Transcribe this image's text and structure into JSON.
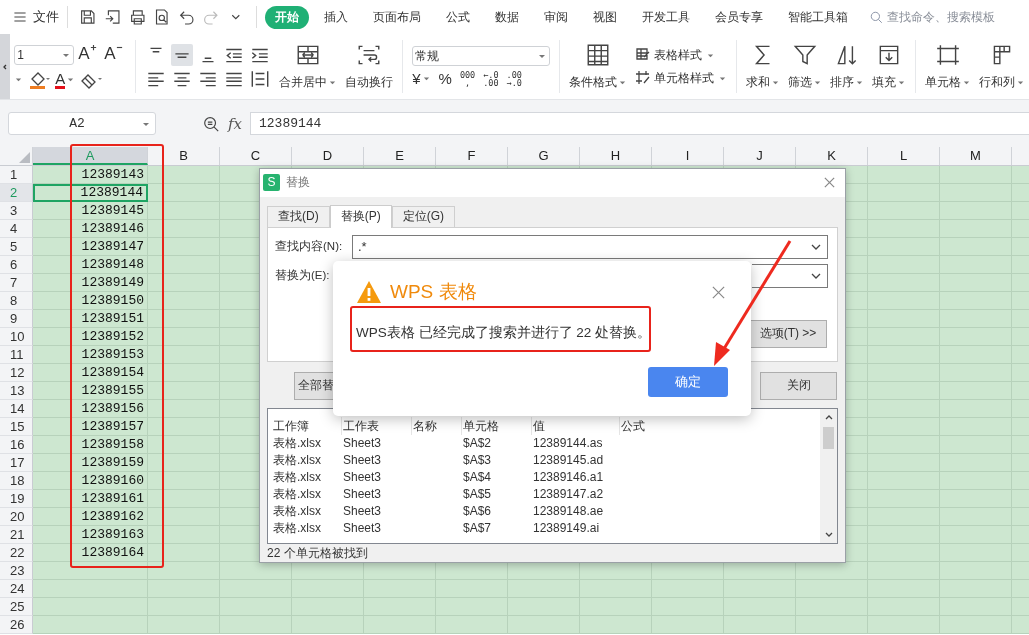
{
  "menu": {
    "file": "文件",
    "quick_access": [
      {
        "kind": "save",
        "disabled": false
      },
      {
        "kind": "export",
        "disabled": false
      },
      {
        "kind": "print",
        "disabled": false
      },
      {
        "kind": "preview",
        "disabled": false
      },
      {
        "kind": "undo",
        "disabled": false
      },
      {
        "kind": "redo",
        "disabled": true
      },
      {
        "kind": "more",
        "disabled": false
      }
    ],
    "tabs": [
      {
        "label": "开始",
        "selected": true
      },
      {
        "label": "插入",
        "selected": false
      },
      {
        "label": "页面布局",
        "selected": false
      },
      {
        "label": "公式",
        "selected": false
      },
      {
        "label": "数据",
        "selected": false
      },
      {
        "label": "审阅",
        "selected": false
      },
      {
        "label": "视图",
        "selected": false
      },
      {
        "label": "开发工具",
        "selected": false
      },
      {
        "label": "会员专享",
        "selected": false
      },
      {
        "label": "智能工具箱",
        "selected": false
      }
    ],
    "search": {
      "placeholder": "查找命令、搜索模板"
    }
  },
  "ribbon": {
    "font_size": "1",
    "font_grow": "A",
    "font_shrink": "A",
    "font_color": "A",
    "align_top": [
      {
        "kind": "top",
        "selected": false
      },
      {
        "kind": "middle",
        "selected": true
      },
      {
        "kind": "bottom",
        "selected": false
      },
      {
        "kind": "outdent",
        "selected": false
      },
      {
        "kind": "indent",
        "selected": false
      }
    ],
    "align_bottom": [
      {
        "kind": "left",
        "selected": false
      },
      {
        "kind": "center",
        "selected": false
      },
      {
        "kind": "right",
        "selected": false
      },
      {
        "kind": "justify",
        "selected": false
      },
      {
        "kind": "distributed",
        "selected": false
      }
    ],
    "merge": {
      "label": "合并居中",
      "kind": "merge"
    },
    "wrap": {
      "label": "自动换行",
      "kind": "wrap"
    },
    "number_format": "常规",
    "currency": "¥",
    "percent": "%",
    "thousands": [
      "000",
      ","
    ],
    "inc_decimal": [
      "←.0",
      ".00"
    ],
    "dec_decimal": [
      ".00",
      "→.0"
    ],
    "conditional": {
      "label": "条件格式",
      "kind": "conditional"
    },
    "table_style": "表格样式",
    "cell_style": "单元格样式",
    "tools": [
      {
        "label": "求和",
        "kind": "sum"
      },
      {
        "label": "筛选",
        "kind": "filter"
      },
      {
        "label": "排序",
        "kind": "sort"
      },
      {
        "label": "填充",
        "kind": "fill"
      }
    ],
    "cells": [
      {
        "label": "单元格",
        "kind": "cell"
      },
      {
        "label": "行和列",
        "kind": "rowcol"
      }
    ]
  },
  "formula_bar": {
    "name_box": "A2",
    "fx": "fx",
    "value": "12389144"
  },
  "sheet": {
    "columns": [
      {
        "label": "A",
        "selected": true
      },
      {
        "label": "B",
        "selected": false
      },
      {
        "label": "C",
        "selected": false
      },
      {
        "label": "D",
        "selected": false
      },
      {
        "label": "E",
        "selected": false
      },
      {
        "label": "F",
        "selected": false
      },
      {
        "label": "G",
        "selected": false
      },
      {
        "label": "H",
        "selected": false
      },
      {
        "label": "I",
        "selected": false
      },
      {
        "label": "J",
        "selected": false
      },
      {
        "label": "K",
        "selected": false
      },
      {
        "label": "L",
        "selected": false
      },
      {
        "label": "M",
        "selected": false
      }
    ],
    "rows": [
      {
        "number": "1",
        "value": "12389143",
        "selected": false
      },
      {
        "number": "2",
        "value": "12389144",
        "selected": true
      },
      {
        "number": "3",
        "value": "12389145",
        "selected": false
      },
      {
        "number": "4",
        "value": "12389146",
        "selected": false
      },
      {
        "number": "5",
        "value": "12389147",
        "selected": false
      },
      {
        "number": "6",
        "value": "12389148",
        "selected": false
      },
      {
        "number": "7",
        "value": "12389149",
        "selected": false
      },
      {
        "number": "8",
        "value": "12389150",
        "selected": false
      },
      {
        "number": "9",
        "value": "12389151",
        "selected": false
      },
      {
        "number": "10",
        "value": "12389152",
        "selected": false
      },
      {
        "number": "11",
        "value": "12389153",
        "selected": false
      },
      {
        "number": "12",
        "value": "12389154",
        "selected": false
      },
      {
        "number": "13",
        "value": "12389155",
        "selected": false
      },
      {
        "number": "14",
        "value": "12389156",
        "selected": false
      },
      {
        "number": "15",
        "value": "12389157",
        "selected": false
      },
      {
        "number": "16",
        "value": "12389158",
        "selected": false
      },
      {
        "number": "17",
        "value": "12389159",
        "selected": false
      },
      {
        "number": "18",
        "value": "12389160",
        "selected": false
      },
      {
        "number": "19",
        "value": "12389161",
        "selected": false
      },
      {
        "number": "20",
        "value": "12389162",
        "selected": false
      },
      {
        "number": "21",
        "value": "12389163",
        "selected": false
      },
      {
        "number": "22",
        "value": "12389164",
        "selected": false
      },
      {
        "number": "23",
        "selected": false
      },
      {
        "number": "24",
        "selected": false
      },
      {
        "number": "25",
        "selected": false
      },
      {
        "number": "26",
        "selected": false
      }
    ]
  },
  "replace_dialog": {
    "logo": "S",
    "title": "替换",
    "tabs": [
      {
        "label": "查找(D)",
        "selected": false
      },
      {
        "label": "替换(P)",
        "selected": true
      },
      {
        "label": "定位(G)",
        "selected": false
      }
    ],
    "find_label": "查找内容(N):",
    "find_value": ".*",
    "replace_label": "替换为(E):",
    "options_button": "选项(T) >>",
    "replace_all_button": "全部替",
    "close_button": "关闭",
    "results": {
      "columns": [
        "工作簿",
        "工作表",
        "名称",
        "单元格",
        "值",
        "公式"
      ],
      "rows": [
        [
          "表格.xlsx",
          "Sheet3",
          "",
          "$A$2",
          "12389144.as",
          ""
        ],
        [
          "表格.xlsx",
          "Sheet3",
          "",
          "$A$3",
          "12389145.ad",
          ""
        ],
        [
          "表格.xlsx",
          "Sheet3",
          "",
          "$A$4",
          "12389146.a1",
          ""
        ],
        [
          "表格.xlsx",
          "Sheet3",
          "",
          "$A$5",
          "12389147.a2",
          ""
        ],
        [
          "表格.xlsx",
          "Sheet3",
          "",
          "$A$6",
          "12389148.ae",
          ""
        ],
        [
          "表格.xlsx",
          "Sheet3",
          "",
          "$A$7",
          "12389149.ai",
          ""
        ]
      ]
    },
    "status": "22 个单元格被找到"
  },
  "message_box": {
    "title": "WPS 表格",
    "text": "WPS表格 已经完成了搜索并进行了 22 处替换。",
    "ok_button": "确定"
  }
}
